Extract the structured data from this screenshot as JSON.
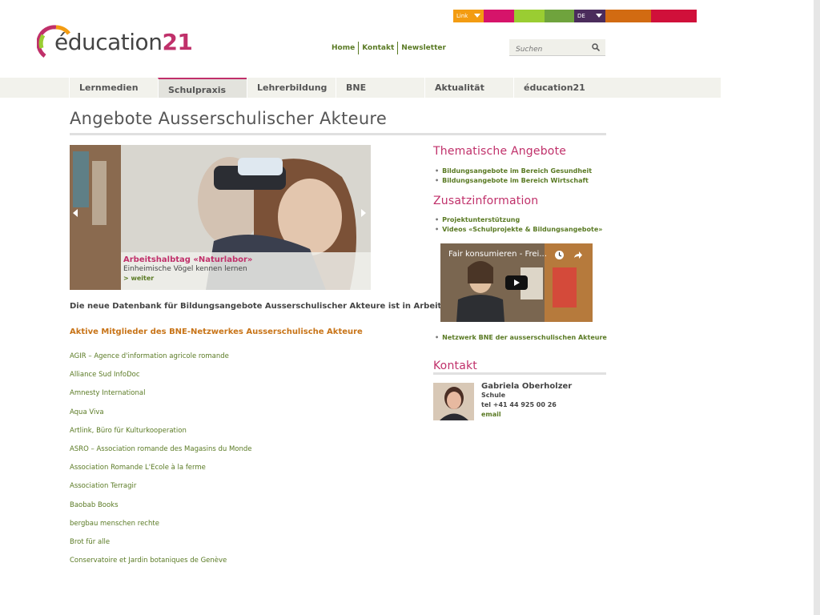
{
  "topbar": {
    "link_label": "Link",
    "lang_label": "DE",
    "colors": [
      "#f39c12",
      "#d6146a",
      "#9acd32",
      "#6fa33d",
      "#4b2c5c",
      "#d26b12",
      "#d0103a"
    ]
  },
  "logo": {
    "text": "éducation",
    "number": "21"
  },
  "servicenav": {
    "items": [
      "Home",
      "Kontakt",
      "Newsletter"
    ]
  },
  "search": {
    "placeholder": "Suchen"
  },
  "mainnav": {
    "tabs": [
      "Lernmedien",
      "Schulpraxis",
      "Lehrerbildung",
      "BNE",
      "Aktualität",
      "éducation21"
    ],
    "active": "Schulpraxis"
  },
  "page": {
    "title": "Angebote Ausserschulischer Akteure"
  },
  "slider": {
    "caption_title": "Arbeitshalbtag «Naturlabor»",
    "caption_sub": "Einheimische Vögel kennen lernen",
    "caption_more": "> weiter"
  },
  "intro": "Die neue Datenbank für Bildungsangebote Ausserschulischer Akteure ist  in Arbeit.",
  "members": {
    "heading": "Aktive Mitglieder des BNE-Netzwerkes Ausserschulische Akteure",
    "items": [
      "AGIR – Agence d'information agricole romande",
      "Alliance Sud InfoDoc",
      "Amnesty International",
      "Aqua Viva",
      "Artlink, Büro für Kulturkooperation",
      "ASRO – Association romande des Magasins du Monde",
      "Association Romande L'Ecole à la ferme",
      "Association Terragir",
      "Baobab Books",
      "bergbau menschen rechte",
      "Brot für alle",
      "Conservatoire et Jardin botaniques de Genève"
    ]
  },
  "sidebar": {
    "thematic_heading": "Thematische Angebote",
    "thematic_items": [
      "Bildungsangebote im Bereich Gesundheit",
      "Bildungsangebote im Bereich Wirtschaft"
    ],
    "additional_heading": "Zusatzinformation",
    "additional_items": [
      "Projektunterstützung",
      "Videos «Schulprojekte & Bildungsangebote»"
    ],
    "video_title": "Fair konsumieren - Frei...",
    "network_items": [
      "Netzwerk BNE der ausserschulischen Akteure"
    ],
    "contact_heading": "Kontakt",
    "contact": {
      "name": "Gabriela Oberholzer",
      "role": "Schule",
      "phone": "tel +41 44 925 00 26",
      "email": "email"
    }
  }
}
